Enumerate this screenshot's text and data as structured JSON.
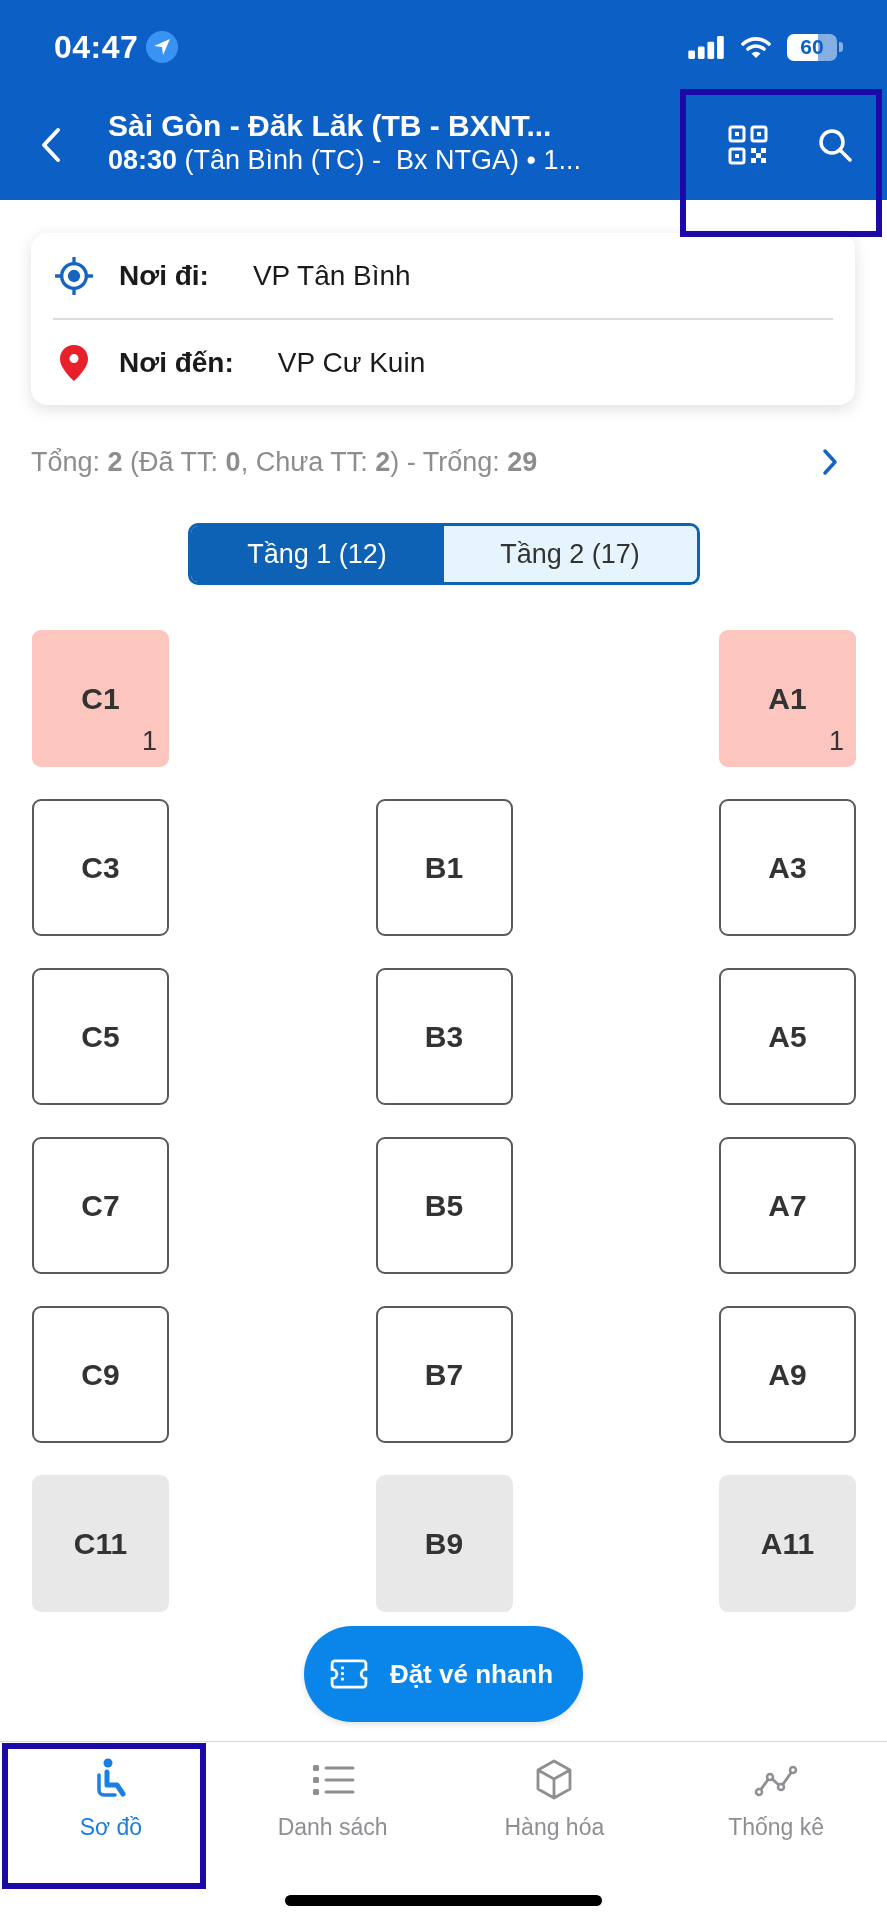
{
  "status_bar": {
    "time": "04:47",
    "battery": "60"
  },
  "header": {
    "title": "Sài Gòn - Đăk Lăk (TB - BXNT...",
    "subtitle": "**08:30** (Tân Bình (TC) -  Bx NTGA) • 1...",
    "actions_highlighted": true
  },
  "route": [
    {
      "kind": "origin",
      "label": "Nơi đi:",
      "value": "VP Tân Bình"
    },
    {
      "kind": "destination",
      "label": "Nơi đến:",
      "value": "VP Cư Kuin"
    }
  ],
  "summary": "Tổng: **2** (Đã TT: **0**, Chưa TT: **2**) - Trống: **29**",
  "floors": [
    {
      "label": "Tầng 1 (12)",
      "selected": true
    },
    {
      "label": "Tầng 2 (17)",
      "selected": false
    }
  ],
  "seat_rows": [
    {
      "seats": [
        {
          "kind": "booked",
          "label": "C1",
          "count": "1"
        },
        {
          "kind": "none"
        },
        {
          "kind": "booked",
          "label": "A1",
          "count": "1"
        }
      ]
    },
    {
      "seats": [
        {
          "kind": "free",
          "label": "C3"
        },
        {
          "kind": "free",
          "label": "B1"
        },
        {
          "kind": "free",
          "label": "A3"
        }
      ]
    },
    {
      "seats": [
        {
          "kind": "free",
          "label": "C5"
        },
        {
          "kind": "free",
          "label": "B3"
        },
        {
          "kind": "free",
          "label": "A5"
        }
      ]
    },
    {
      "seats": [
        {
          "kind": "free",
          "label": "C7"
        },
        {
          "kind": "free",
          "label": "B5"
        },
        {
          "kind": "free",
          "label": "A7"
        }
      ]
    },
    {
      "seats": [
        {
          "kind": "free",
          "label": "C9"
        },
        {
          "kind": "free",
          "label": "B7"
        },
        {
          "kind": "free",
          "label": "A9"
        }
      ]
    },
    {
      "seats": [
        {
          "kind": "locked",
          "label": "C11"
        },
        {
          "kind": "locked",
          "label": "B9"
        },
        {
          "kind": "locked",
          "label": "A11"
        }
      ]
    }
  ],
  "quick_book_button": "Đặt vé nhanh",
  "nav": [
    {
      "kind": "seat_map",
      "label": "Sơ đồ",
      "selected": true,
      "highlighted": true
    },
    {
      "kind": "list",
      "label": "Danh sách",
      "selected": false,
      "highlighted": false
    },
    {
      "kind": "goods",
      "label": "Hàng hóa",
      "selected": false,
      "highlighted": false
    },
    {
      "kind": "stats",
      "label": "Thống kê",
      "selected": false,
      "highlighted": false
    }
  ]
}
